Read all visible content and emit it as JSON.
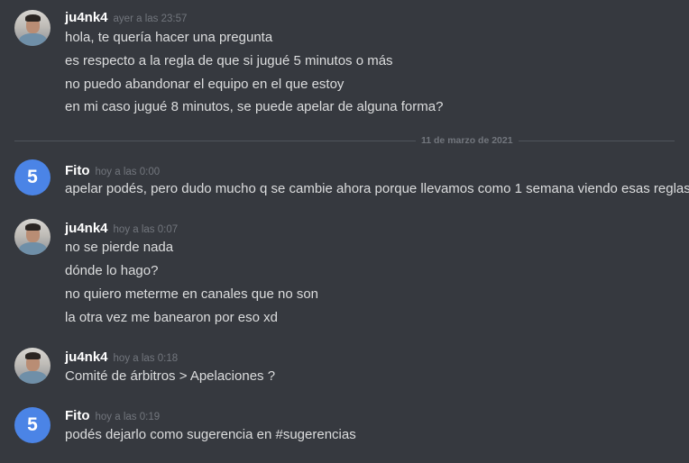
{
  "divider": {
    "date_label": "11 de marzo de 2021"
  },
  "messages": [
    {
      "author": "ju4nk4",
      "timestamp": "ayer a las 23:57",
      "avatar": "user-photo-avatar",
      "lines": [
        "hola, te quería hacer una pregunta",
        "es respecto a la regla de que si jugué 5 minutos o más",
        "no puedo abandonar el equipo en el que estoy",
        "en mi caso jugué 8 minutos, se puede apelar de alguna forma?"
      ]
    },
    {
      "author": "Fito",
      "timestamp": "hoy a las 0:00",
      "avatar_text": "5",
      "lines": [
        "apelar podés, pero dudo mucho q se cambie ahora porque llevamos como 1 semana viendo esas reglas"
      ]
    },
    {
      "author": "ju4nk4",
      "timestamp": "hoy a las 0:07",
      "avatar": "user-photo-avatar",
      "lines": [
        "no se pierde nada",
        "dónde lo hago?",
        "no quiero meterme en canales que no son",
        "la otra vez me banearon por eso xd"
      ]
    },
    {
      "author": "ju4nk4",
      "timestamp": "hoy a las 0:18",
      "avatar": "user-photo-avatar",
      "lines": [
        "Comité de árbitros > Apelaciones ?"
      ]
    },
    {
      "author": "Fito",
      "timestamp": "hoy a las 0:19",
      "avatar_text": "5",
      "lines": [
        "podés dejarlo como sugerencia en #sugerencias"
      ]
    }
  ],
  "colors": {
    "background": "#36393f",
    "username": "#ffffff",
    "message_text": "#dcddde",
    "timestamp": "#72767d",
    "avatar_blue": "#4b84e6"
  }
}
